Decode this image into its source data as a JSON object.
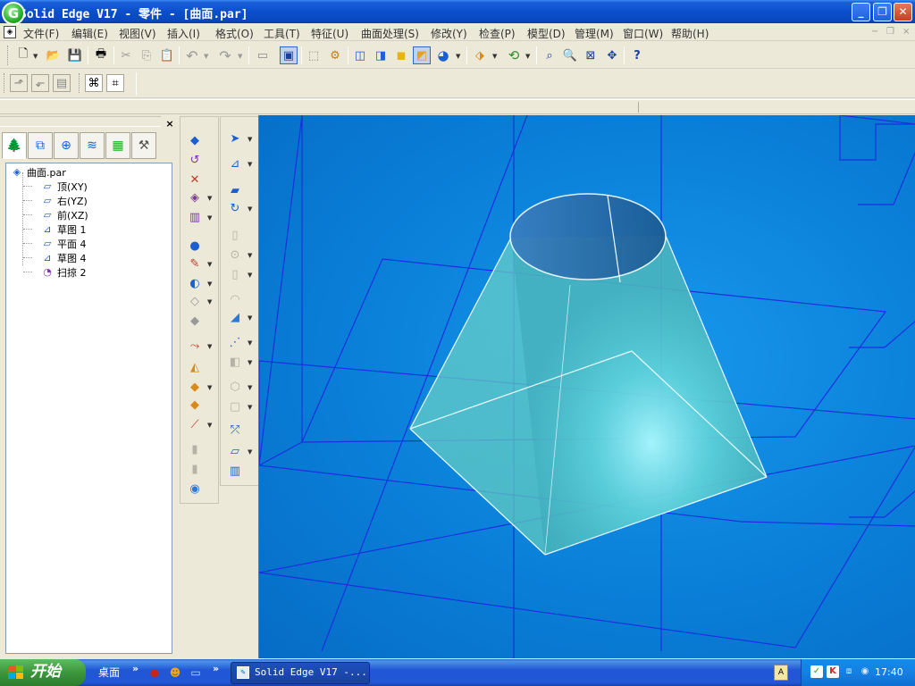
{
  "window": {
    "title": "Solid Edge V17 - 零件 - [曲面.par]",
    "app_icon_label": "G",
    "minimize_glyph": "_",
    "restore_glyph": "❐",
    "close_glyph": "✕"
  },
  "menu": {
    "items": [
      {
        "label": "文件(F)"
      },
      {
        "label": "编辑(E)"
      },
      {
        "label": "视图(V)"
      },
      {
        "label": "插入(I)"
      },
      {
        "label": "格式(O)"
      },
      {
        "label": "工具(T)"
      },
      {
        "label": "特征(U)"
      },
      {
        "label": "曲面处理(S)"
      },
      {
        "label": "修改(Y)"
      },
      {
        "label": "检查(P)"
      },
      {
        "label": "模型(D)"
      },
      {
        "label": "管理(M)"
      },
      {
        "label": "窗口(W)"
      },
      {
        "label": "帮助(H)"
      }
    ],
    "mdi_controls": [
      "−",
      "❐",
      "×"
    ]
  },
  "toolbar_main": {
    "buttons": [
      {
        "icon": "new-file-icon",
        "glyph": "🗋"
      },
      {
        "icon": "open-folder-icon",
        "glyph": "📂"
      },
      {
        "icon": "save-icon",
        "glyph": "💾"
      },
      {
        "icon": "print-icon",
        "glyph": "🖶"
      },
      {
        "icon": "cut-icon",
        "glyph": "✂"
      },
      {
        "icon": "copy-icon",
        "glyph": "⎘"
      },
      {
        "icon": "paste-icon",
        "glyph": "📋"
      },
      {
        "icon": "undo-icon",
        "glyph": "↶"
      },
      {
        "icon": "redo-icon",
        "glyph": "↷"
      },
      {
        "icon": "new-window-icon",
        "glyph": "▭"
      },
      {
        "icon": "select-mode-icon",
        "glyph": "▣"
      },
      {
        "icon": "sketch-view-icon",
        "glyph": "⬚"
      },
      {
        "icon": "section-icon",
        "glyph": "⚙"
      },
      {
        "icon": "iso-view-icon",
        "glyph": "◫"
      },
      {
        "icon": "view-cube-icon",
        "glyph": "◨"
      },
      {
        "icon": "shaded-icon",
        "glyph": "◼"
      },
      {
        "icon": "shaded-edges-icon",
        "glyph": "◩"
      },
      {
        "icon": "render-sphere-icon",
        "glyph": "◕"
      },
      {
        "icon": "view-orient-icon",
        "glyph": "⬗"
      },
      {
        "icon": "rotate-icon",
        "glyph": "⟲"
      },
      {
        "icon": "zoom-area-icon",
        "glyph": "⌕"
      },
      {
        "icon": "zoom-icon",
        "glyph": "🔍"
      },
      {
        "icon": "fit-icon",
        "glyph": "⊠"
      },
      {
        "icon": "pan-icon",
        "glyph": "✥"
      },
      {
        "icon": "help-whats-this-icon",
        "glyph": "?"
      }
    ]
  },
  "toolbar_second": {
    "buttons": [
      {
        "icon": "feature-edit-icon",
        "glyph": "⬏"
      },
      {
        "icon": "feature-next-icon",
        "glyph": "⬐"
      },
      {
        "icon": "feature-list-icon",
        "glyph": "▤"
      },
      {
        "icon": "relations-icon",
        "glyph": "⌘"
      },
      {
        "icon": "relations-alt-icon",
        "glyph": "⌗"
      }
    ]
  },
  "edgebar": {
    "close_glyph": "×",
    "tabs": [
      {
        "icon": "feature-tree-tab-icon",
        "glyph": "🌲"
      },
      {
        "icon": "library-tab-icon",
        "glyph": "⧉"
      },
      {
        "icon": "layers-tab-icon",
        "glyph": "⊕"
      },
      {
        "icon": "family-tab-icon",
        "glyph": "≋"
      },
      {
        "icon": "sensor-tab-icon",
        "glyph": "▦"
      },
      {
        "icon": "properties-tab-icon",
        "glyph": "⚒"
      }
    ],
    "tree": {
      "root": {
        "label": "曲面.par",
        "glyph": "◈"
      },
      "items": [
        {
          "label": "顶(XY)",
          "glyph": "▱",
          "icon": "plane-icon"
        },
        {
          "label": "右(YZ)",
          "glyph": "▱",
          "icon": "plane-icon"
        },
        {
          "label": "前(XZ)",
          "glyph": "▱",
          "icon": "plane-icon"
        },
        {
          "label": "草图 1",
          "glyph": "⊿",
          "icon": "sketch-icon"
        },
        {
          "label": "平面 4",
          "glyph": "▱",
          "icon": "plane-icon"
        },
        {
          "label": "草图 4",
          "glyph": "⊿",
          "icon": "sketch-icon"
        },
        {
          "label": "扫掠 2",
          "glyph": "◔",
          "icon": "sweep-icon"
        }
      ]
    }
  },
  "feature_bar_left": {
    "buttons": [
      {
        "icon": "extrude-surface-icon",
        "glyph": "◆",
        "color": "#1b5fd1"
      },
      {
        "icon": "revolve-surface-icon",
        "glyph": "↺",
        "color": "#8a2fb5"
      },
      {
        "icon": "sweep-surface-icon",
        "glyph": "✕",
        "color": "#c0392b"
      },
      {
        "icon": "loft-surface-icon",
        "glyph": "◈",
        "color": "#7a3aa0"
      },
      {
        "icon": "bounded-surface-icon",
        "glyph": "▥",
        "color": "#7a3aa0"
      },
      {
        "icon": "point-icon",
        "glyph": "●",
        "color": "#1b5fd1"
      },
      {
        "icon": "curve-icon",
        "glyph": "✎",
        "color": "#c0392b"
      },
      {
        "icon": "offset-surface-icon",
        "glyph": "◐",
        "color": "#1b5fd1"
      },
      {
        "icon": "copy-surface-icon",
        "glyph": "◇",
        "color": "#999999"
      },
      {
        "icon": "trim-surface-icon",
        "glyph": "◆",
        "color": "#999999"
      },
      {
        "icon": "extend-surface-icon",
        "glyph": "⤳",
        "color": "#c0392b"
      },
      {
        "icon": "split-icon",
        "glyph": "◭",
        "color": "#d88a1a"
      },
      {
        "icon": "stitch-icon",
        "glyph": "◆",
        "color": "#d88a1a"
      },
      {
        "icon": "thicken-icon",
        "glyph": "◆",
        "color": "#d88a1a"
      },
      {
        "icon": "intersection-icon",
        "glyph": "⟋",
        "color": "#c0392b"
      },
      {
        "icon": "replace-face-icon",
        "glyph": "▮",
        "color": "#b5b2a6"
      },
      {
        "icon": "delete-face-icon",
        "glyph": "▮",
        "color": "#b5b2a6"
      },
      {
        "icon": "blend-icon",
        "glyph": "◉",
        "color": "#2a7ad8"
      }
    ]
  },
  "feature_bar_right": {
    "buttons": [
      {
        "icon": "select-arrow-icon",
        "glyph": "➤",
        "color": "#1b5fd1"
      },
      {
        "icon": "sketch-tool-icon",
        "glyph": "⊿",
        "color": "#1b5fd1"
      },
      {
        "icon": "protrusion-icon",
        "glyph": "▰",
        "color": "#1b5fd1"
      },
      {
        "icon": "revolved-protrusion-icon",
        "glyph": "↻",
        "color": "#1b5fd1"
      },
      {
        "icon": "cutout-icon",
        "glyph": "▯",
        "color": "#b5b2a6"
      },
      {
        "icon": "hole-icon",
        "glyph": "⊙",
        "color": "#b5b2a6"
      },
      {
        "icon": "rib-icon",
        "glyph": "▯",
        "color": "#b5b2a6"
      },
      {
        "icon": "round-icon",
        "glyph": "◠",
        "color": "#b5b2a6"
      },
      {
        "icon": "blue-surface-icon",
        "glyph": "◢",
        "color": "#2a7ad8"
      },
      {
        "icon": "pattern-icon",
        "glyph": "⋰",
        "color": "#1b5fd1"
      },
      {
        "icon": "mirror-icon",
        "glyph": "◧",
        "color": "#b5b2a6"
      },
      {
        "icon": "thin-wall-icon",
        "glyph": "⬡",
        "color": "#b5b2a6"
      },
      {
        "icon": "shell-icon",
        "glyph": "▢",
        "color": "#b5b2a6"
      },
      {
        "icon": "construction-icon",
        "glyph": "⤱",
        "color": "#1b5fd1"
      },
      {
        "icon": "plane-tool-icon",
        "glyph": "▱",
        "color": "#1b5fd1"
      },
      {
        "icon": "part-copy-icon",
        "glyph": "▥",
        "color": "#1b5fd1"
      }
    ]
  },
  "taskbar": {
    "start_label": "开始",
    "desktop_label": "桌面",
    "chevron": "»",
    "task_label": "Solid Edge V17 -...",
    "task_icon_glyph": "✎",
    "lang_glyph": "A",
    "clock": "17:40",
    "quick_launch": [
      {
        "icon": "media-icon",
        "glyph": "●",
        "color": "#c0281c"
      },
      {
        "icon": "messenger-icon",
        "glyph": "☻",
        "color": "#f2a21b"
      },
      {
        "icon": "show-desktop-icon",
        "glyph": "▭",
        "color": "#aee0ff"
      }
    ],
    "tray_icons": [
      {
        "icon": "check-icon",
        "glyph": "✓",
        "color": "#1fa82a"
      },
      {
        "icon": "antivirus-icon",
        "glyph": "K",
        "color": "#d8202a"
      },
      {
        "icon": "network-icon",
        "glyph": "⧈",
        "color": "#6aa7e8"
      },
      {
        "icon": "volume-icon",
        "glyph": "◉",
        "color": "#9ab4d6"
      }
    ]
  }
}
